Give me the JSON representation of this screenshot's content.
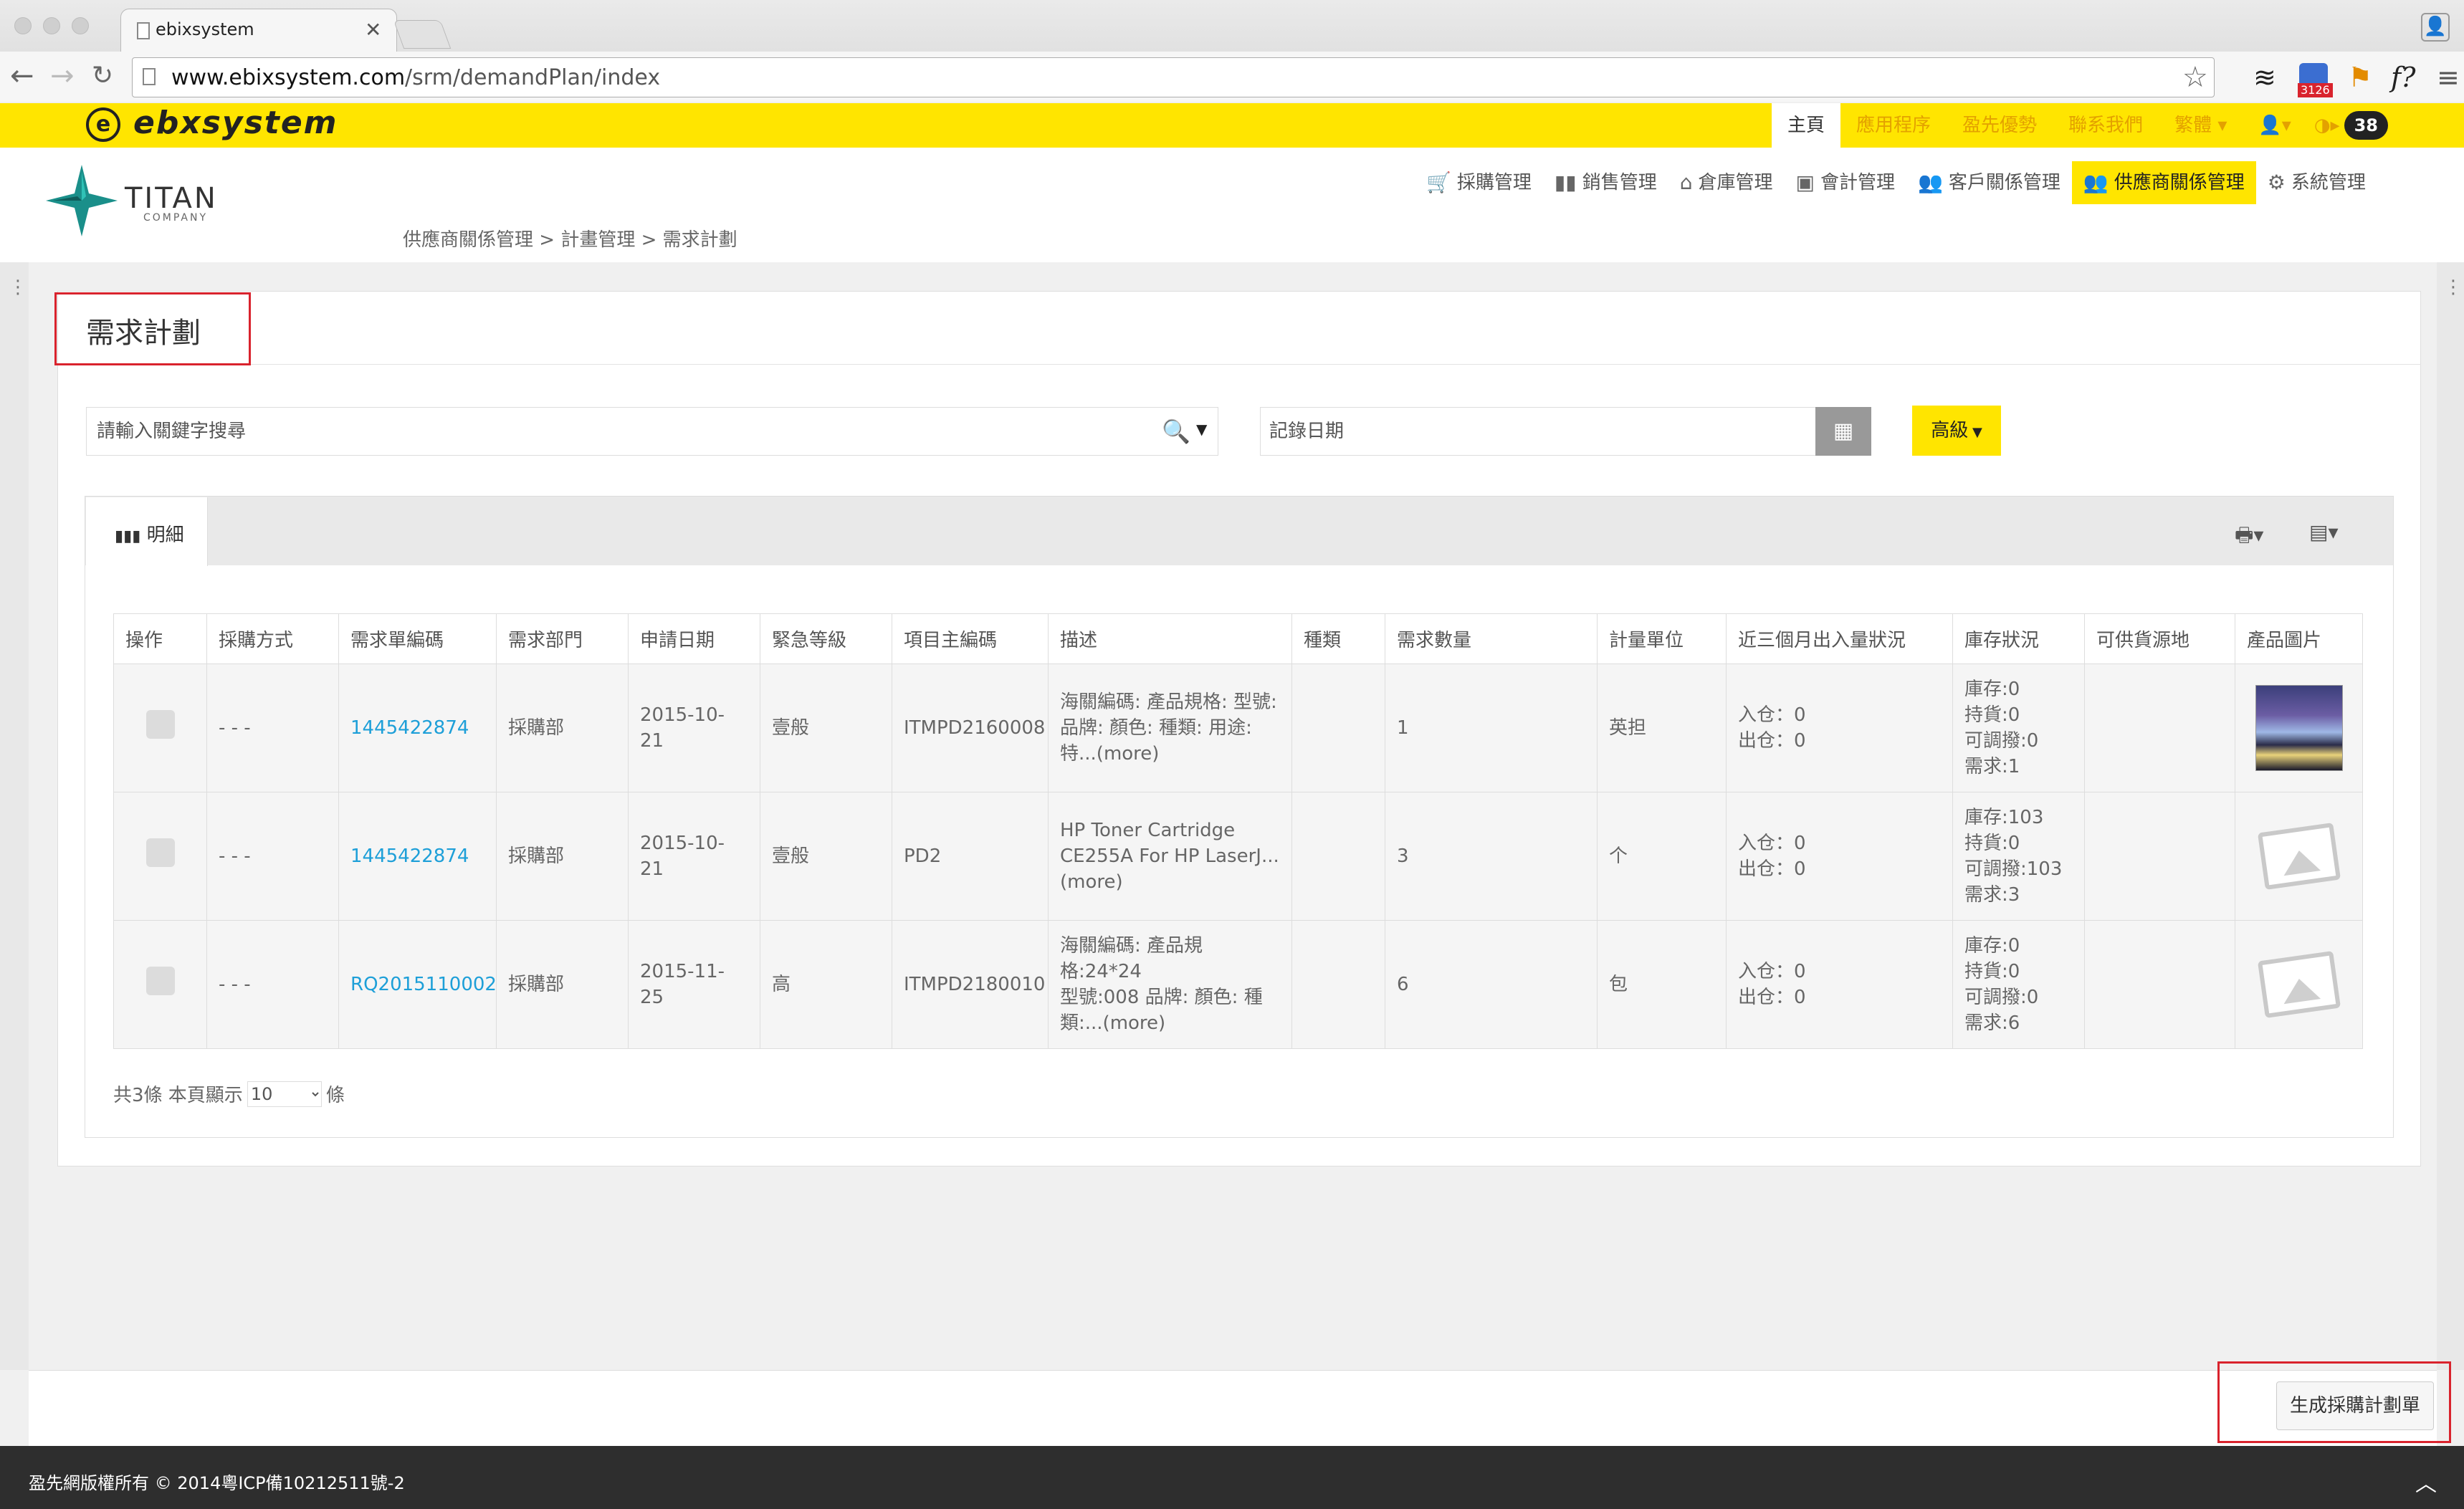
{
  "browser": {
    "tab_title": "ebixsystem",
    "tab_close": "✕",
    "url_host": "www.ebixsystem.com",
    "url_path": "/srm/demandPlan/index",
    "ext_badge": "3126"
  },
  "topbar": {
    "logo_text": "ebxsystem",
    "nav": [
      {
        "label": "主頁"
      },
      {
        "label": "應用程序"
      },
      {
        "label": "盈先優勢"
      },
      {
        "label": "聯系我們"
      },
      {
        "label": "繁體 ▾"
      }
    ],
    "badge": "38"
  },
  "header": {
    "brand": "TITAN",
    "brand_sub": "COMPANY",
    "menu": [
      {
        "label": "採購管理"
      },
      {
        "label": "銷售管理"
      },
      {
        "label": "倉庫管理"
      },
      {
        "label": "會計管理"
      },
      {
        "label": "客戶關係管理"
      },
      {
        "label": "供應商關係管理"
      },
      {
        "label": "系統管理"
      }
    ],
    "breadcrumb": "供應商關係管理 > 計畫管理 > 需求計劃"
  },
  "page": {
    "title": "需求計劃",
    "search_placeholder": "請輸入關鍵字搜尋",
    "date_placeholder": "記錄日期",
    "advanced_label": "高級",
    "tab_detail": "明細"
  },
  "table": {
    "columns": [
      "操作",
      "採購方式",
      "需求單編碼",
      "需求部門",
      "申請日期",
      "緊急等級",
      "項目主編碼",
      "描述",
      "種類",
      "需求數量",
      "計量單位",
      "近三個月出入量狀況",
      "庫存狀況",
      "可供貨源地",
      "產品圖片"
    ],
    "rows": [
      {
        "method": "- - -",
        "code": "1445422874",
        "dept": "採購部",
        "date": "2015-10-21",
        "urgency": "壹般",
        "item_code": "ITMPD2160008",
        "desc_lines": [
          "海關編碼: 產品規格: 型號:",
          "品牌: 顏色: 種類: 用途:",
          "特...(more)"
        ],
        "kind": "",
        "qty": "1",
        "unit": "英担",
        "flow_lines": [
          "入仓：0",
          "出仓：0"
        ],
        "stock_lines": [
          "庫存:0",
          "持貨:0",
          "可調撥:0",
          "需求:1"
        ],
        "source": ""
      },
      {
        "method": "- - -",
        "code": "1445422874",
        "dept": "採購部",
        "date": "2015-10-21",
        "urgency": "壹般",
        "item_code": "PD2",
        "desc_lines": [
          "HP Toner Cartridge",
          "CE255A For HP LaserJ...",
          "(more)"
        ],
        "kind": "",
        "qty": "3",
        "unit": "个",
        "flow_lines": [
          "入仓：0",
          "出仓：0"
        ],
        "stock_lines": [
          "庫存:103",
          "持貨:0",
          "可調撥:103",
          "需求:3"
        ],
        "source": ""
      },
      {
        "method": "- - -",
        "code": "RQ2015110002",
        "dept": "採購部",
        "date": "2015-11-25",
        "urgency": "高",
        "item_code": "ITMPD2180010",
        "desc_lines": [
          "海關編碼: 產品規格:24*24",
          "型號:008 品牌: 顏色: 種",
          "類:...(more)"
        ],
        "kind": "",
        "qty": "6",
        "unit": "包",
        "flow_lines": [
          "入仓：0",
          "出仓：0"
        ],
        "stock_lines": [
          "庫存:0",
          "持貨:0",
          "可調撥:0",
          "需求:6"
        ],
        "source": ""
      }
    ]
  },
  "pager": {
    "prefix": "共3條 本頁顯示",
    "page_size": "10",
    "suffix": "條"
  },
  "footer": {
    "generate_button": "生成採購計劃單",
    "copyright": "盈先網版權所有 © 2014粵ICP備10212511號-2"
  },
  "colors": {
    "brand_yellow": "#ffe500",
    "link_blue": "#1d9fd8",
    "highlight_red": "#d9232d"
  }
}
